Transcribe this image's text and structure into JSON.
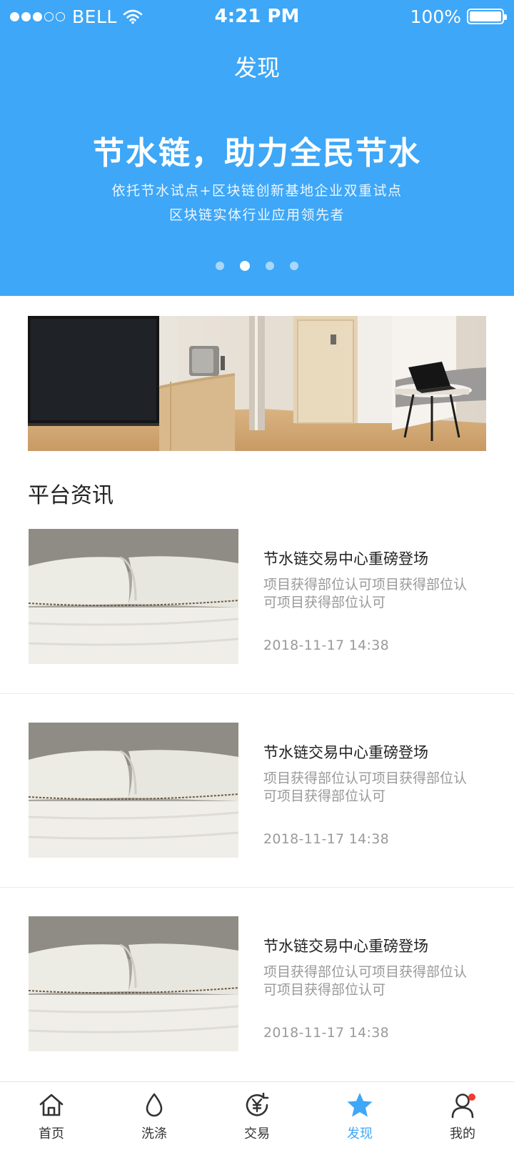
{
  "status_bar": {
    "carrier": "BELL",
    "time": "4:21 PM",
    "battery": "100%",
    "signal_bars_filled": 3,
    "signal_bars_total": 5
  },
  "nav": {
    "title": "发现"
  },
  "banner": {
    "headline": "节水链，助力全民节水",
    "line1": "依托节水试点+区块链创新基地企业双重试点",
    "line2": "区块链实体行业应用领先者",
    "page_count": 4,
    "active_page": 2
  },
  "section": {
    "title": "平台资讯"
  },
  "news": [
    {
      "title": "节水链交易中心重磅登场",
      "desc": "项目获得部位认可项目获得部位认可项目获得部位认可",
      "time": "2018-11-17 14:38"
    },
    {
      "title": "节水链交易中心重磅登场",
      "desc": "项目获得部位认可项目获得部位认可项目获得部位认可",
      "time": "2018-11-17 14:38"
    },
    {
      "title": "节水链交易中心重磅登场",
      "desc": "项目获得部位认可项目获得部位认可项目获得部位认可",
      "time": "2018-11-17 14:38"
    }
  ],
  "tabs": [
    {
      "label": "首页",
      "icon": "home-icon"
    },
    {
      "label": "洗涤",
      "icon": "water-drop-icon"
    },
    {
      "label": "交易",
      "icon": "yuan-exchange-icon"
    },
    {
      "label": "发现",
      "icon": "star-icon",
      "active": true
    },
    {
      "label": "我的",
      "icon": "user-icon",
      "badge": true
    }
  ],
  "colors": {
    "primary": "#3ea7f7",
    "badge": "#f23b30",
    "text": "#222222",
    "muted": "#999999"
  }
}
